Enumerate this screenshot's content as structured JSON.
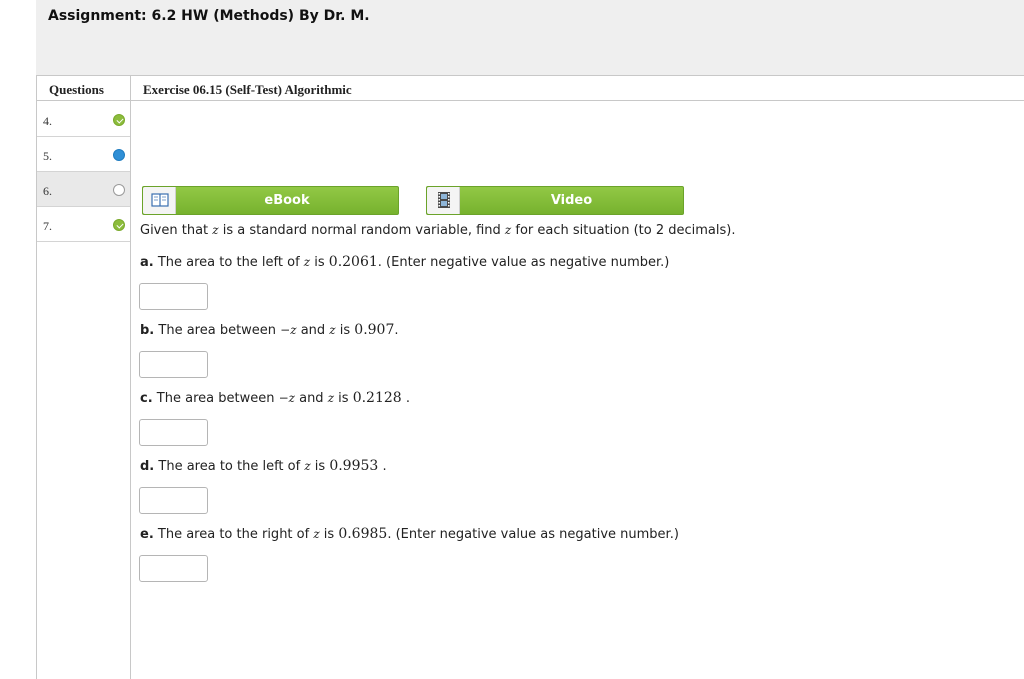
{
  "assignment": {
    "title": "Assignment: 6.2 HW (Methods) By Dr. M."
  },
  "questions_panel": {
    "header": "Questions",
    "items": [
      {
        "num": "4.",
        "status": "check-icon"
      },
      {
        "num": "5.",
        "status": "current-icon"
      },
      {
        "num": "6.",
        "status": "unanswered-icon"
      },
      {
        "num": "7.",
        "status": "check-icon"
      }
    ]
  },
  "exercise": {
    "title": "Exercise 06.15 (Self-Test) Algorithmic",
    "ebook_label": "eBook",
    "video_label": "Video",
    "prompt": {
      "t1": "Given that ",
      "z": "z",
      "t2": " is a standard normal random variable, find ",
      "t3": " for each situation (to 2 decimals)."
    },
    "parts": {
      "a": {
        "letter": "a.",
        "t1": " The area to the left of ",
        "z": "z",
        "t2": " is ",
        "value": "0.2061",
        "t3": ". (Enter negative value as negative number.)"
      },
      "b": {
        "letter": "b.",
        "t1": " The area between ",
        "negz": "−z",
        "t2": " and ",
        "z": "z",
        "t3": " is ",
        "value": "0.907",
        "t4": "."
      },
      "c": {
        "letter": "c.",
        "t1": " The area between ",
        "negz": "−z",
        "t2": " and ",
        "z": "z",
        "t3": " is ",
        "value": "0.2128",
        "t4": " ."
      },
      "d": {
        "letter": "d.",
        "t1": " The area to the left of ",
        "z": "z",
        "t2": " is ",
        "value": "0.9953",
        "t3": " ."
      },
      "e": {
        "letter": "e.",
        "t1": " The area to the right of ",
        "z": "z",
        "t2": " is ",
        "value": "0.6985",
        "t3": ". (Enter negative value as negative number.)"
      }
    }
  },
  "colors": {
    "button_green": "#86bf3b",
    "check_green": "#8cbc3c",
    "current_blue": "#2f8fd6",
    "header_gray": "#efefef"
  }
}
